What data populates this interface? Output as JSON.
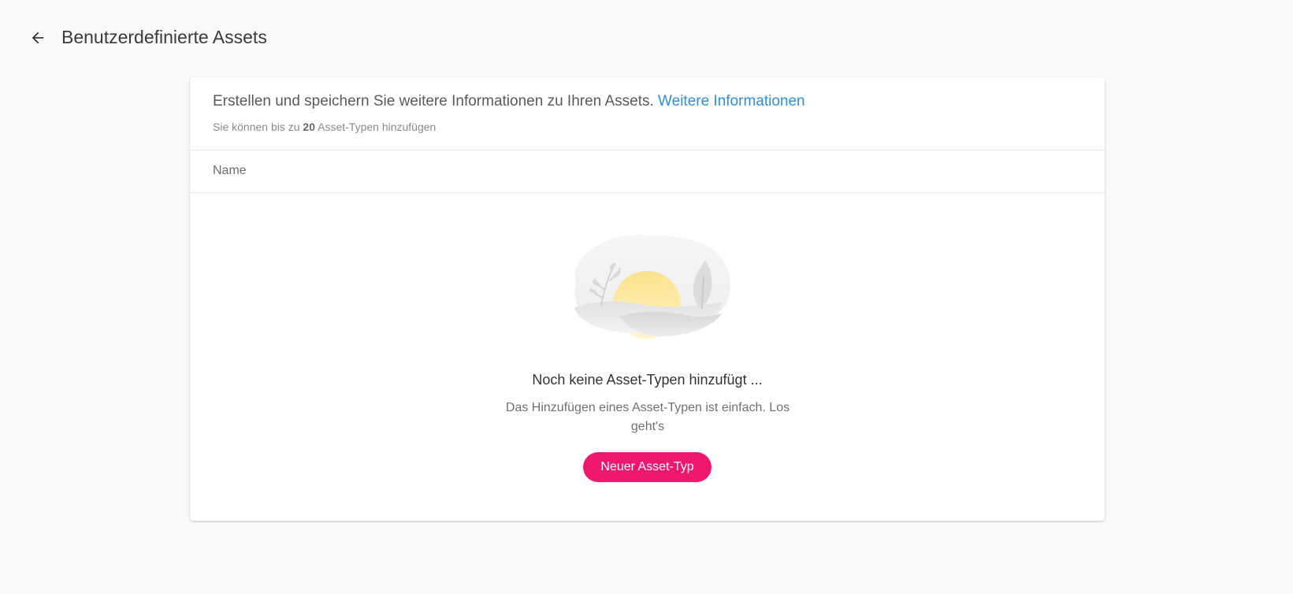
{
  "header": {
    "title": "Benutzerdefinierte Assets",
    "back_icon": "arrow-left-icon"
  },
  "card": {
    "intro_text": "Erstellen und speichern Sie weitere Informationen zu Ihren Assets.",
    "intro_link": "Weitere Informationen",
    "limit_prefix": "Sie können bis zu",
    "limit_count": "20",
    "limit_suffix": "Asset-Typen hinzufügen",
    "column_name": "Name"
  },
  "empty_state": {
    "illustration": "empty-landscape-illustration",
    "title": "Noch keine Asset-Typen hinzufügt ...",
    "text": "Das Hinzufügen eines Asset-Typen ist einfach. Los geht's",
    "button_label": "Neuer Asset-Typ"
  },
  "colors": {
    "accent": "#f0176e",
    "link": "#2b8fe0",
    "background": "#f9f9f9"
  }
}
